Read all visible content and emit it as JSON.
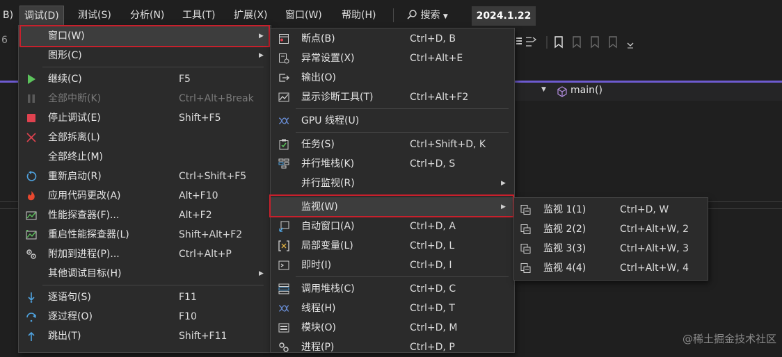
{
  "menubar": {
    "partial_left": "B)",
    "items": [
      "调试(D)",
      "测试(S)",
      "分析(N)",
      "工具(T)",
      "扩展(X)",
      "窗口(W)",
      "帮助(H)"
    ],
    "search_label": "搜索",
    "date": "2024.1.22"
  },
  "toolbar": {
    "partial_number": "6"
  },
  "editor": {
    "function_label": "main()"
  },
  "debug_menu": {
    "items": [
      {
        "label": "窗口(W)",
        "shortcut": "",
        "icon": "none",
        "submenu": true,
        "highlighted": true
      },
      {
        "label": "图形(C)",
        "shortcut": "",
        "icon": "none",
        "submenu": true
      },
      {
        "label": "继续(C)",
        "shortcut": "F5",
        "icon": "play-icon"
      },
      {
        "label": "全部中断(K)",
        "shortcut": "Ctrl+Alt+Break",
        "icon": "pause-icon",
        "disabled": true
      },
      {
        "label": "停止调试(E)",
        "shortcut": "Shift+F5",
        "icon": "stop-icon"
      },
      {
        "label": "全部拆离(L)",
        "shortcut": "",
        "icon": "detach-icon"
      },
      {
        "label": "全部终止(M)",
        "shortcut": "",
        "icon": "none"
      },
      {
        "label": "重新启动(R)",
        "shortcut": "Ctrl+Shift+F5",
        "icon": "restart-icon"
      },
      {
        "label": "应用代码更改(A)",
        "shortcut": "Alt+F10",
        "icon": "hot-reload-icon"
      },
      {
        "label": "性能探查器(F)...",
        "shortcut": "Alt+F2",
        "icon": "profiler-icon"
      },
      {
        "label": "重启性能探查器(L)",
        "shortcut": "Shift+Alt+F2",
        "icon": "profiler-restart-icon"
      },
      {
        "label": "附加到进程(P)...",
        "shortcut": "Ctrl+Alt+P",
        "icon": "attach-process-icon"
      },
      {
        "label": "其他调试目标(H)",
        "shortcut": "",
        "icon": "none",
        "submenu": true
      },
      {
        "label": "逐语句(S)",
        "shortcut": "F11",
        "icon": "step-into-icon"
      },
      {
        "label": "逐过程(O)",
        "shortcut": "F10",
        "icon": "step-over-icon"
      },
      {
        "label": "跳出(T)",
        "shortcut": "Shift+F11",
        "icon": "step-out-icon"
      }
    ]
  },
  "window_menu": {
    "items": [
      {
        "label": "断点(B)",
        "shortcut": "Ctrl+D, B",
        "icon": "breakpoints-icon"
      },
      {
        "label": "异常设置(X)",
        "shortcut": "Ctrl+Alt+E",
        "icon": "exception-settings-icon"
      },
      {
        "label": "输出(O)",
        "shortcut": "",
        "icon": "output-icon"
      },
      {
        "label": "显示诊断工具(T)",
        "shortcut": "Ctrl+Alt+F2",
        "icon": "diagnostic-tools-icon"
      },
      {
        "label": "GPU 线程(U)",
        "shortcut": "",
        "icon": "gpu-threads-icon"
      },
      {
        "label": "任务(S)",
        "shortcut": "Ctrl+Shift+D, K",
        "icon": "tasks-icon"
      },
      {
        "label": "并行堆栈(K)",
        "shortcut": "Ctrl+D, S",
        "icon": "parallel-stacks-icon"
      },
      {
        "label": "并行监视(R)",
        "shortcut": "",
        "icon": "none",
        "submenu": true
      },
      {
        "label": "监视(W)",
        "shortcut": "",
        "icon": "none",
        "submenu": true,
        "highlighted": true
      },
      {
        "label": "自动窗口(A)",
        "shortcut": "Ctrl+D, A",
        "icon": "autos-icon"
      },
      {
        "label": "局部变量(L)",
        "shortcut": "Ctrl+D, L",
        "icon": "locals-icon"
      },
      {
        "label": "即时(I)",
        "shortcut": "Ctrl+D, I",
        "icon": "immediate-icon"
      },
      {
        "label": "调用堆栈(C)",
        "shortcut": "Ctrl+D, C",
        "icon": "call-stack-icon"
      },
      {
        "label": "线程(H)",
        "shortcut": "Ctrl+D, T",
        "icon": "threads-icon"
      },
      {
        "label": "模块(O)",
        "shortcut": "Ctrl+D, M",
        "icon": "modules-icon"
      },
      {
        "label": "进程(P)",
        "shortcut": "Ctrl+D, P",
        "icon": "processes-icon"
      }
    ]
  },
  "watch_menu": {
    "items": [
      {
        "label": "监视 1(1)",
        "shortcut": "Ctrl+D, W",
        "icon": "watch-icon"
      },
      {
        "label": "监视 2(2)",
        "shortcut": "Ctrl+Alt+W, 2",
        "icon": "watch-icon"
      },
      {
        "label": "监视 3(3)",
        "shortcut": "Ctrl+Alt+W, 3",
        "icon": "watch-icon"
      },
      {
        "label": "监视 4(4)",
        "shortcut": "Ctrl+Alt+W, 4",
        "icon": "watch-icon"
      }
    ]
  },
  "watermark": "@稀土掘金技术社区",
  "colors": {
    "accent": "#6e5bd0",
    "highlight_border": "#c8202c",
    "menu_bg": "#2b2b2b"
  }
}
